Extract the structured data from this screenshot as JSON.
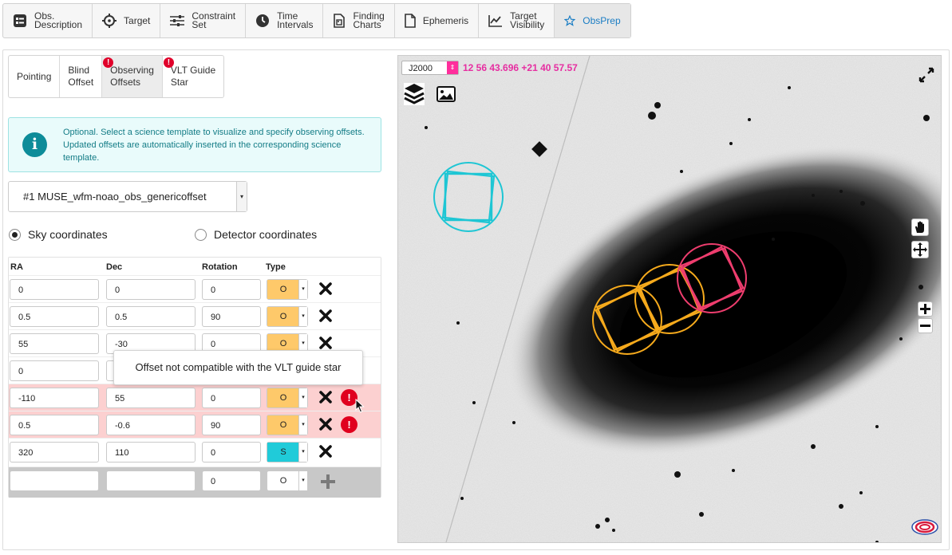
{
  "top_tabs": [
    {
      "label": "Obs.\nDescription",
      "icon": "obs-description-icon"
    },
    {
      "label": "Target",
      "icon": "target-icon"
    },
    {
      "label": "Constraint\nSet",
      "icon": "sliders-icon"
    },
    {
      "label": "Time\nIntervals",
      "icon": "clock-icon"
    },
    {
      "label": "Finding\nCharts",
      "icon": "finding-chart-icon"
    },
    {
      "label": "Ephemeris",
      "icon": "file-icon"
    },
    {
      "label": "Target\nVisibility",
      "icon": "chart-line-icon"
    },
    {
      "label": "ObsPrep",
      "icon": "star-icon",
      "active": true
    }
  ],
  "sub_tabs": [
    {
      "label": "Pointing"
    },
    {
      "label": "Blind\nOffset"
    },
    {
      "label": "Observing\nOffsets",
      "badge": "!",
      "active": true
    },
    {
      "label": "VLT Guide\nStar",
      "badge": "!"
    }
  ],
  "info": {
    "icon": "i",
    "text": "Optional. Select a science template to visualize and specify observing offsets. Updated offsets are automatically inserted in the corresponding science template."
  },
  "template_select": {
    "value": "#1 MUSE_wfm-noao_obs_genericoffset",
    "arrow": "▾"
  },
  "coords": {
    "sky": "Sky coordinates",
    "detector": "Detector coordinates",
    "selected": "sky"
  },
  "table": {
    "headers": {
      "ra": "RA",
      "dec": "Dec",
      "rot": "Rotation",
      "type": "Type"
    },
    "rows": [
      {
        "ra": "0",
        "dec": "0",
        "rot": "0",
        "type": "O",
        "error": false
      },
      {
        "ra": "0.5",
        "dec": "0.5",
        "rot": "90",
        "type": "O",
        "error": false
      },
      {
        "ra": "55",
        "dec": "-30",
        "rot": "0",
        "type": "O",
        "error": false
      },
      {
        "ra": "0",
        "dec": "",
        "rot": "",
        "type": "",
        "error": false
      },
      {
        "ra": "-110",
        "dec": "55",
        "rot": "0",
        "type": "O",
        "error": true
      },
      {
        "ra": "0.5",
        "dec": "-0.6",
        "rot": "90",
        "type": "O",
        "error": true
      },
      {
        "ra": "320",
        "dec": "110",
        "rot": "0",
        "type": "S",
        "error": false
      }
    ],
    "new_row": {
      "ra": "",
      "dec": "",
      "rot": "0",
      "type": "O"
    },
    "error_badge": "!",
    "type_arrow": "▾"
  },
  "tooltip": "Offset not compatible with the VLT guide star",
  "viewer": {
    "frame": "J2000",
    "frame_arrow": "⇕",
    "coordinate": "12 56 43.696 +21 40 57.57",
    "colors": {
      "science": "#f6aa1c",
      "error": "#ee3d6e",
      "sky": "#1ec6d4",
      "coord": "#e62ea1"
    }
  },
  "colors": {
    "accent": "#1a7dc4",
    "error": "#e0001e",
    "object_type": "#fec96a",
    "sky_type": "#20cbd9"
  }
}
